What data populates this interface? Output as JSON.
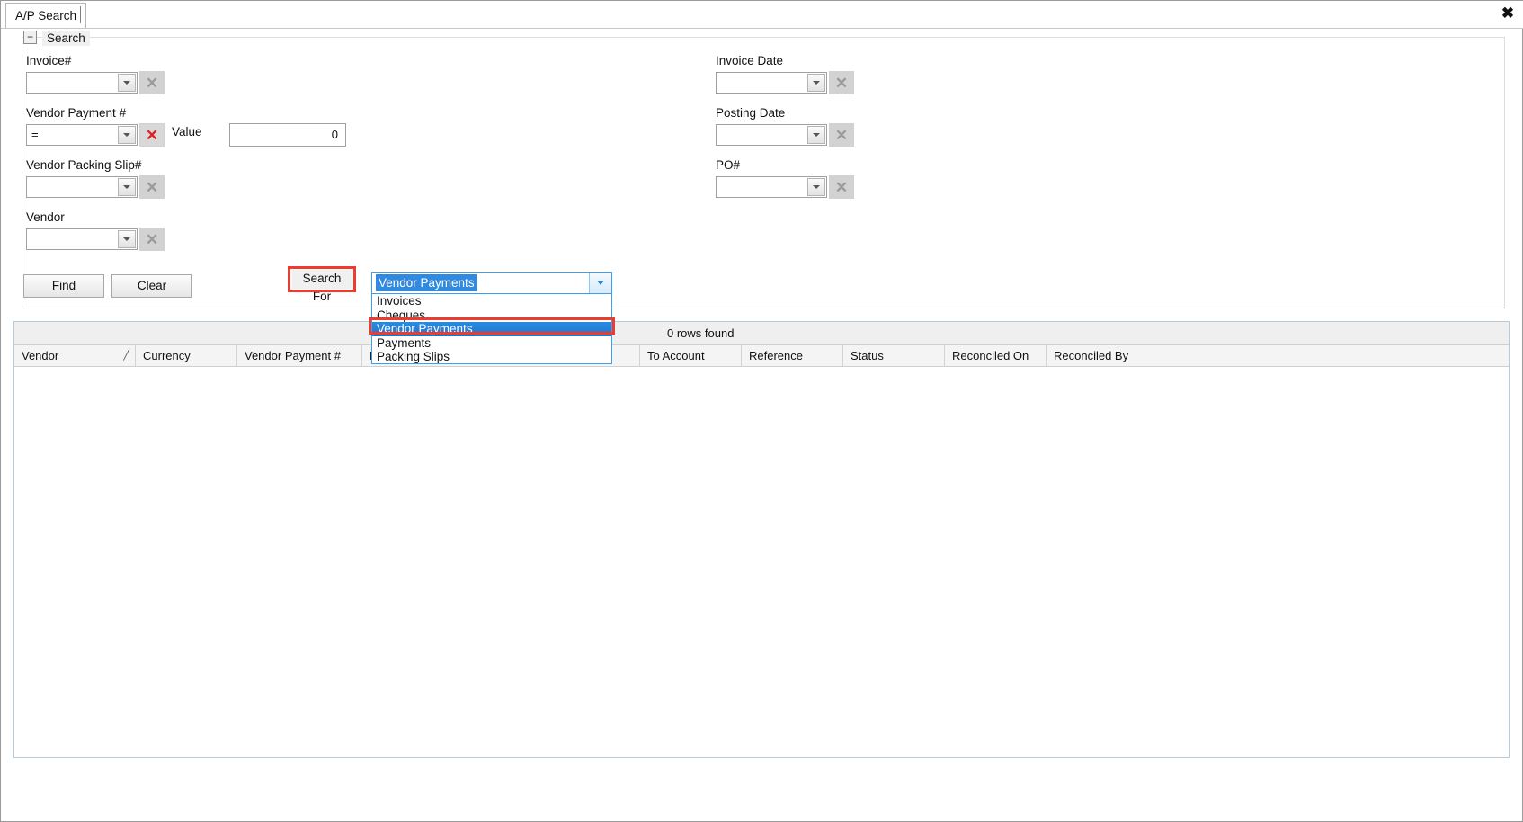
{
  "window": {
    "tab_label": "A/P Search",
    "close_icon": "close-icon"
  },
  "search_group": {
    "title": "Search",
    "toggle_glyph": "−",
    "fields": {
      "invoice_number": {
        "label": "Invoice#",
        "value": "",
        "clear_label": "✕",
        "clear_enabled": false
      },
      "vendor_payment_number": {
        "label": "Vendor Payment #",
        "value": "=",
        "clear_label": "✕",
        "clear_enabled": true
      },
      "vendor_packing_slip": {
        "label": "Vendor Packing Slip#",
        "value": "",
        "clear_label": "✕",
        "clear_enabled": false
      },
      "vendor": {
        "label": "Vendor",
        "value": "",
        "clear_label": "✕",
        "clear_enabled": false
      },
      "value": {
        "label": "Value",
        "value": "0"
      },
      "invoice_date": {
        "label": "Invoice Date",
        "value": "",
        "clear_label": "✕",
        "clear_enabled": false
      },
      "posting_date": {
        "label": "Posting Date",
        "value": "",
        "clear_label": "✕",
        "clear_enabled": false
      },
      "po_number": {
        "label": "PO#",
        "value": "",
        "clear_label": "✕",
        "clear_enabled": false
      }
    },
    "buttons": {
      "find": "Find",
      "clear": "Clear"
    },
    "search_for": {
      "label": "Search For",
      "selected": "Vendor Payments",
      "options": [
        "Invoices",
        "Cheques",
        "Vendor Payments",
        "Payments",
        "Packing Slips"
      ],
      "selected_index": 2
    }
  },
  "results": {
    "rows_found": "0 rows found",
    "columns": [
      {
        "label": "Vendor",
        "sort": "╱"
      },
      {
        "label": "Currency",
        "sort": ""
      },
      {
        "label": "Vendor Payment #",
        "sort": ""
      },
      {
        "label": "P",
        "sort": ""
      },
      {
        "label": "To Account",
        "sort": ""
      },
      {
        "label": "Reference",
        "sort": ""
      },
      {
        "label": "Status",
        "sort": ""
      },
      {
        "label": "Reconciled On",
        "sort": ""
      },
      {
        "label": "Reconciled By",
        "sort": ""
      }
    ],
    "rows": []
  },
  "colors": {
    "accent_selection": "#2f8ae0",
    "annotation_red": "#ef3b2d",
    "panel_bg": "#f0f0f0",
    "field_border": "#a0a0a0"
  }
}
